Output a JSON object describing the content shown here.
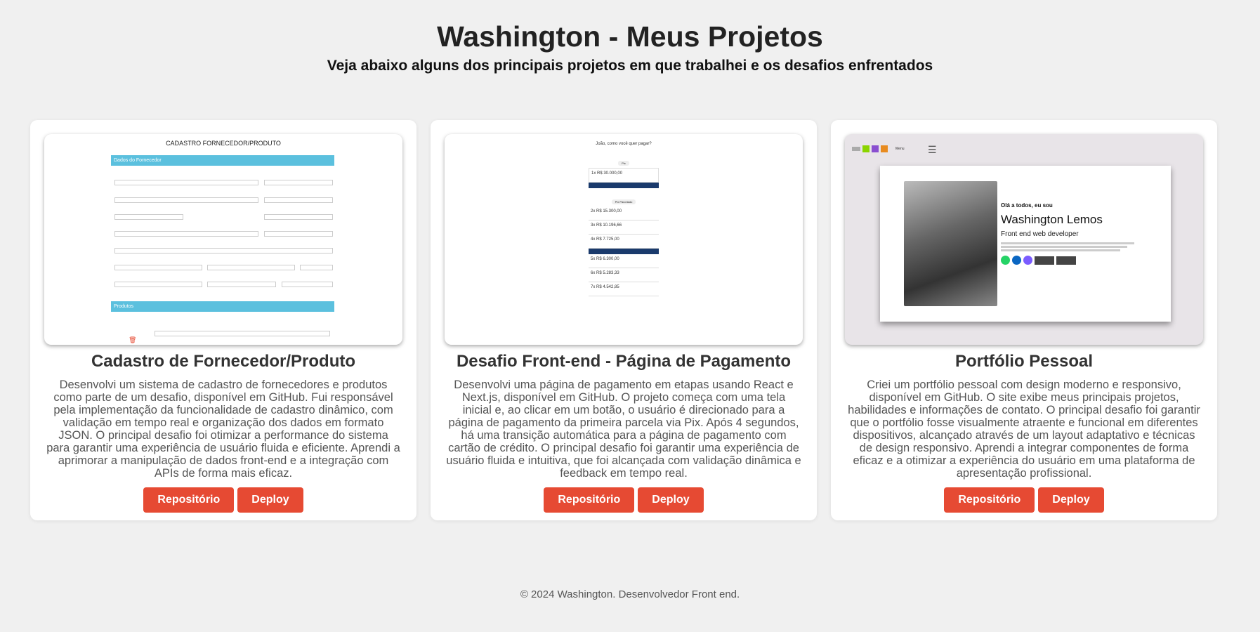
{
  "header": {
    "title": "Washington - Meus Projetos",
    "subtitle": "Veja abaixo alguns dos principais projetos em que trabalhei e os desafios enfrentados"
  },
  "projects": [
    {
      "title": "Cadastro de Fornecedor/Produto",
      "description": "Desenvolvi um sistema de cadastro de fornecedores e produtos como parte de um desafio, disponível em GitHub. Fui responsável pela implementação da funcionalidade de cadastro dinâmico, com validação em tempo real e organização dos dados em formato JSON. O principal desafio foi otimizar a performance do sistema para garantir uma experiência de usuário fluida e eficiente. Aprendi a aprimorar a manipulação de dados front-end e a integração com APIs de forma mais eficaz.",
      "repo_label": "Repositório",
      "deploy_label": "Deploy",
      "thumb": {
        "heading": "CADASTRO FORNECEDOR/PRODUTO",
        "section1": "Dados do Fornecedor",
        "section2": "Produtos"
      }
    },
    {
      "title": "Desafio Front-end - Página de Pagamento",
      "description": "Desenvolvi uma página de pagamento em etapas usando React e Next.js, disponível em GitHub. O projeto começa com uma tela inicial e, ao clicar em um botão, o usuário é direcionado para a página de pagamento da primeira parcela via Pix. Após 4 segundos, há uma transição automática para a página de pagamento com cartão de crédito. O principal desafio foi garantir uma experiência de usuário fluida e intuitiva, que foi alcançada com validação dinâmica e feedback em tempo real.",
      "repo_label": "Repositório",
      "deploy_label": "Deploy",
      "thumb": {
        "heading": "João, como você quer pagar?",
        "tag1": "Pix",
        "row1": "1x R$ 30.000,00",
        "tag2": "Pix Parcelado",
        "rows": [
          "2x R$ 15.300,00",
          "3x R$ 10.196,66",
          "4x R$ 7.725,00",
          "5x R$ 6.300,00",
          "6x R$ 5.283,33",
          "7x R$ 4.542,85"
        ]
      }
    },
    {
      "title": "Portfólio Pessoal",
      "description": "Criei um portfólio pessoal com design moderno e responsivo, disponível em GitHub. O site exibe meus principais projetos, habilidades e informações de contato. O principal desafio foi garantir que o portfólio fosse visualmente atraente e funcional em diferentes dispositivos, alcançado através de um layout adaptativo e técnicas de design responsivo. Aprendi a integrar componentes de forma eficaz e a otimizar a experiência do usuário em uma plataforma de apresentação profissional.",
      "repo_label": "Repositório",
      "deploy_label": "Deploy",
      "thumb": {
        "greeting": "Olá a todos, eu sou",
        "name": "Washington Lemos",
        "role": "Front end web developer",
        "menu": "Menu"
      }
    }
  ],
  "footer": "© 2024 Washington. Desenvolvedor Front end."
}
